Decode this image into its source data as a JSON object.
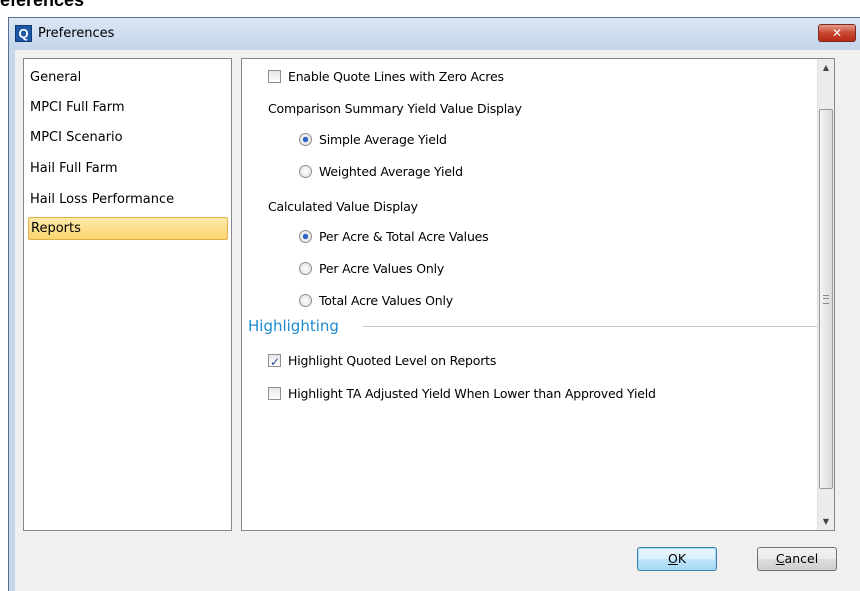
{
  "background_caption": "eferences",
  "window": {
    "title": "Preferences",
    "app_icon": "Q",
    "close_glyph": "✕"
  },
  "nav": {
    "items": [
      {
        "label": "General"
      },
      {
        "label": "MPCI Full Farm"
      },
      {
        "label": "MPCI Scenario"
      },
      {
        "label": "Hail Full Farm"
      },
      {
        "label": "Hail Loss Performance"
      },
      {
        "label": "Reports",
        "selected": true
      }
    ]
  },
  "content": {
    "enable_zero_acres": {
      "label": "Enable Quote Lines with Zero Acres",
      "checked": false
    },
    "comparison_group": {
      "label": "Comparison Summary Yield Value Display",
      "options": [
        {
          "label": "Simple Average Yield",
          "checked": true
        },
        {
          "label": "Weighted Average Yield",
          "checked": false
        }
      ]
    },
    "calculated_group": {
      "label": "Calculated Value Display",
      "options": [
        {
          "label": "Per Acre & Total Acre Values",
          "checked": true
        },
        {
          "label": "Per Acre Values Only",
          "checked": false
        },
        {
          "label": "Total Acre Values Only",
          "checked": false
        }
      ]
    },
    "highlighting": {
      "heading": "Highlighting",
      "options": [
        {
          "label": "Highlight Quoted Level on Reports",
          "checked": true
        },
        {
          "label": "Highlight TA Adjusted Yield When Lower than Approved Yield",
          "checked": false
        }
      ]
    }
  },
  "buttons": {
    "ok": {
      "mnemonic": "O",
      "rest": "K"
    },
    "cancel": {
      "mnemonic": "C",
      "rest": "ancel"
    }
  },
  "icons": {
    "scroll_up": "▲",
    "scroll_down": "▼"
  },
  "colors": {
    "section_heading": "#1e8bd0",
    "selection": "#fbd571"
  }
}
